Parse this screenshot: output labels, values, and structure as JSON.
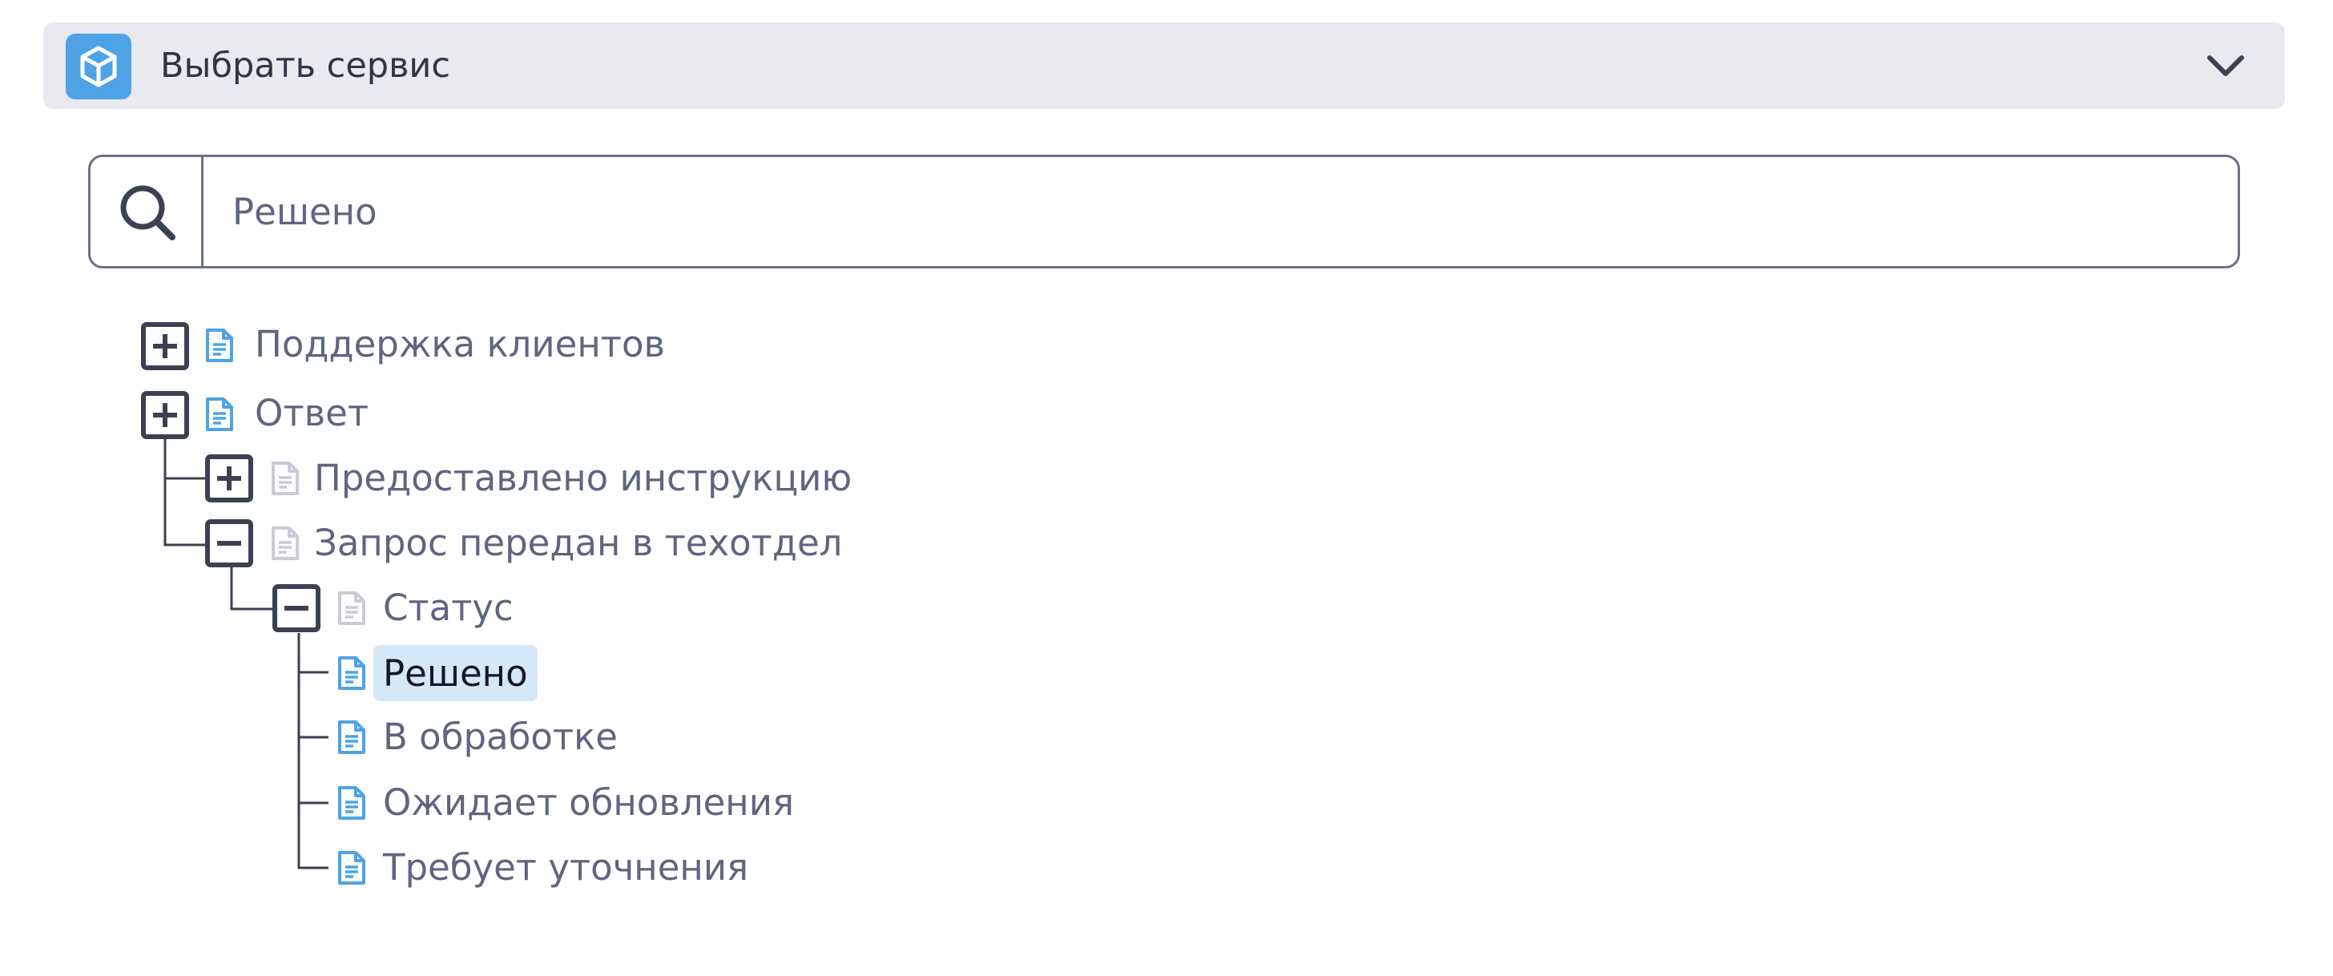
{
  "service_selector": {
    "title": "Выбрать сервис",
    "icon": "cube-icon",
    "accent_color": "#4ea3e6"
  },
  "search": {
    "value": "Решено",
    "icon": "search-icon"
  },
  "tree": {
    "nodes": [
      {
        "label": "Поддержка клиентов",
        "toggle": "plus"
      },
      {
        "label": "Ответ",
        "toggle": "plus"
      },
      {
        "label": "Предоставлено инструкцию",
        "toggle": "plus"
      },
      {
        "label": "Запрос передан в техотдел",
        "toggle": "minus"
      },
      {
        "label": "Статус",
        "toggle": "minus"
      },
      {
        "label": "Решено",
        "selected": true
      },
      {
        "label": "В обработке"
      },
      {
        "label": "Ожидает обновления"
      },
      {
        "label": "Требует уточнения"
      }
    ],
    "selected_highlight_color": "#d5e8f8"
  }
}
